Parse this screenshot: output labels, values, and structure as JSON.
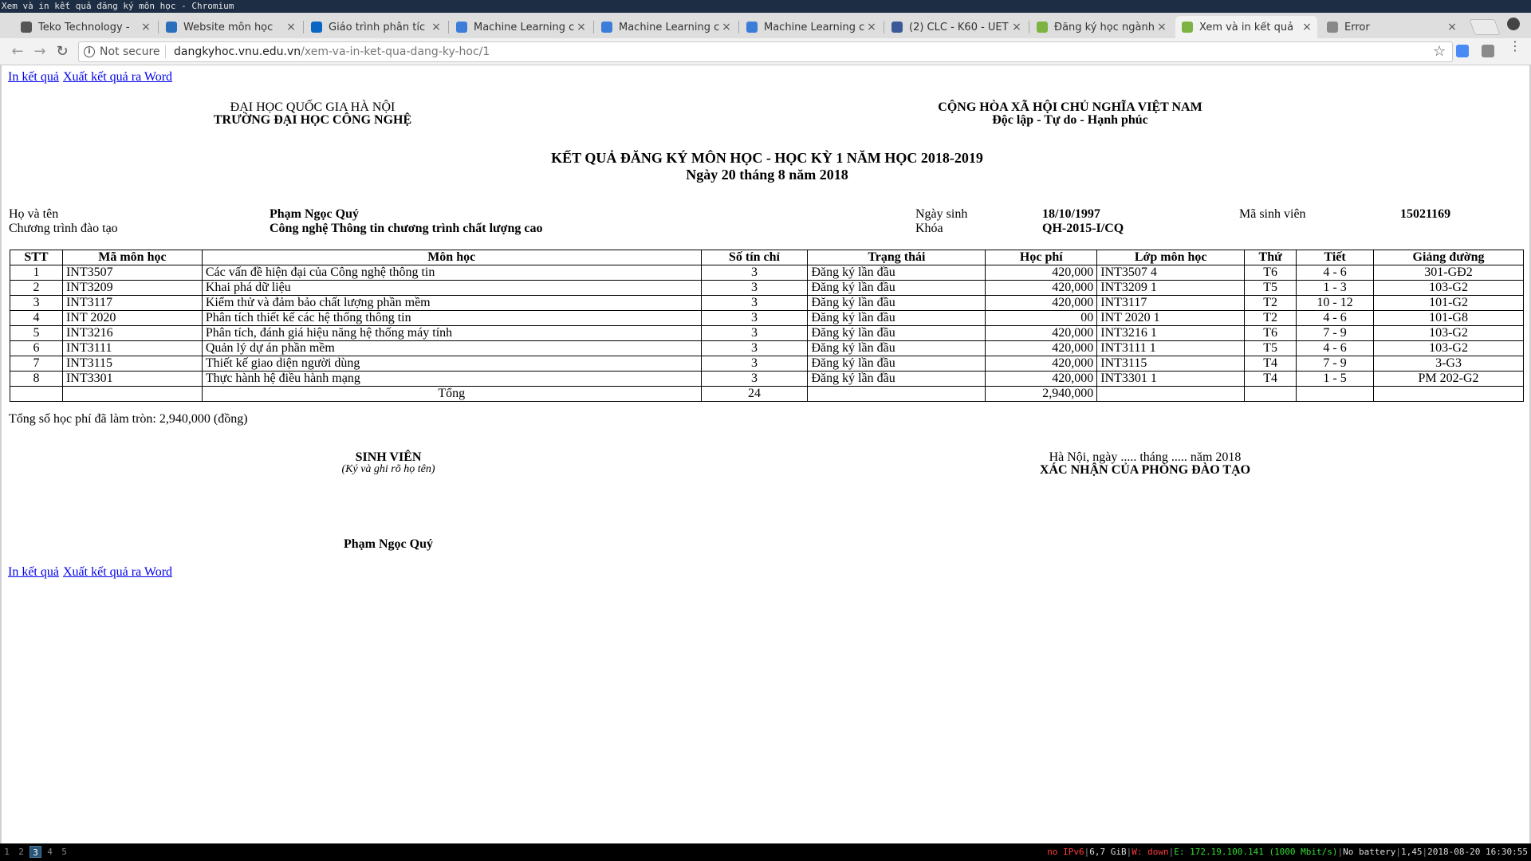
{
  "window": {
    "title": "Xem và in kết quả đăng ký môn học - Chromium"
  },
  "tabs": [
    {
      "title": "Teko Technology - ",
      "favicon": "teko-icon",
      "color": "#555555"
    },
    {
      "title": "Website môn học",
      "favicon": "globe-icon",
      "color": "#2a6fbb"
    },
    {
      "title": "Giáo trình phân tíc",
      "favicon": "linkedin-icon",
      "color": "#0a66c2"
    },
    {
      "title": "Machine Learning c",
      "favicon": "ml-blog-icon",
      "color": "#3b7dd8"
    },
    {
      "title": "Machine Learning c",
      "favicon": "ml-blog-icon",
      "color": "#3b7dd8"
    },
    {
      "title": "Machine Learning c",
      "favicon": "ml-blog-icon",
      "color": "#3b7dd8"
    },
    {
      "title": "(2) CLC - K60 - UET",
      "favicon": "facebook-icon",
      "color": "#3b5998"
    },
    {
      "title": "Đăng ký học ngành",
      "favicon": "vnu-icon",
      "color": "#7cb342"
    },
    {
      "title": "Xem và in kết quả",
      "favicon": "vnu-icon",
      "color": "#7cb342",
      "active": true
    },
    {
      "title": "Error",
      "favicon": "page-icon",
      "color": "#888888"
    }
  ],
  "toolbar": {
    "security_label": "Not secure",
    "url_host": "dangkyhoc.vnu.edu.vn",
    "url_path": "/xem-va-in-ket-qua-dang-ky-hoc/1"
  },
  "page": {
    "print_link": "In kết quả",
    "export_word_link": "Xuất kết quả ra Word",
    "university": "ĐẠI HỌC QUỐC GIA HÀ NỘI",
    "school": "TRƯỜNG ĐẠI HỌC CÔNG NGHỆ",
    "country": "CỘNG HÒA XÃ HỘI CHỦ NGHĨA VIỆT NAM",
    "motto": "Độc lập - Tự do - Hạnh phúc",
    "report_title": "KẾT QUẢ ĐĂNG KÝ MÔN HỌC - HỌC KỲ 1 NĂM HỌC 2018-2019",
    "report_date": "Ngày 20 tháng 8 năm 2018",
    "student": {
      "name_label": "Họ và tên",
      "name": "Phạm Ngọc Quý",
      "program_label": "Chương trình đào tạo",
      "program": "Công nghệ Thông tin chương trình chất lượng cao",
      "dob_label": "Ngày sinh",
      "dob": "18/10/1997",
      "cohort_label": "Khóa",
      "cohort": "QH-2015-I/CQ",
      "id_label": "Mã sinh viên",
      "id": "15021169"
    },
    "table": {
      "headers": [
        "STT",
        "Mã môn học",
        "Môn học",
        "Số tín chỉ",
        "Trạng thái",
        "Học phí",
        "Lớp môn học",
        "Thứ",
        "Tiết",
        "Giảng đường"
      ],
      "rows": [
        [
          "1",
          "INT3507",
          "Các vấn đề hiện đại của Công nghệ thông tin",
          "3",
          "Đăng ký lần đầu",
          "420,000",
          "INT3507 4",
          "T6",
          "4 - 6",
          "301-GĐ2"
        ],
        [
          "2",
          "INT3209",
          "Khai phá dữ liệu",
          "3",
          "Đăng ký lần đầu",
          "420,000",
          "INT3209 1",
          "T5",
          "1 - 3",
          "103-G2"
        ],
        [
          "3",
          "INT3117",
          "Kiểm thử và đảm bảo chất lượng phần mềm",
          "3",
          "Đăng ký lần đầu",
          "420,000",
          "INT3117",
          "T2",
          "10 - 12",
          "101-G2"
        ],
        [
          "4",
          "INT 2020",
          "Phân tích thiết kế các hệ thống thông tin",
          "3",
          "Đăng ký lần đầu",
          "00",
          "INT 2020 1",
          "T2",
          "4 - 6",
          "101-G8"
        ],
        [
          "5",
          "INT3216",
          "Phân tích, đánh giá hiệu năng hệ thống máy tính",
          "3",
          "Đăng ký lần đầu",
          "420,000",
          "INT3216 1",
          "T6",
          "7 - 9",
          "103-G2"
        ],
        [
          "6",
          "INT3111",
          "Quản lý dự án phần mềm",
          "3",
          "Đăng ký lần đầu",
          "420,000",
          "INT3111 1",
          "T5",
          "4 - 6",
          "103-G2"
        ],
        [
          "7",
          "INT3115",
          "Thiết kế giao diện người dùng",
          "3",
          "Đăng ký lần đầu",
          "420,000",
          "INT3115",
          "T4",
          "7 - 9",
          "3-G3"
        ],
        [
          "8",
          "INT3301",
          "Thực hành hệ điều hành mạng",
          "3",
          "Đăng ký lần đầu",
          "420,000",
          "INT3301 1",
          "T4",
          "1 - 5",
          "PM 202-G2"
        ]
      ],
      "total_label": "Tổng",
      "total_credits": "24",
      "total_fee": "2,940,000"
    },
    "fee_summary": "Tổng số học phí đã làm tròn: 2,940,000 (đồng)",
    "sign_student_title": "SINH VIÊN",
    "sign_student_note": "(Ký và ghi rõ họ tên)",
    "sign_place_date": "Hà Nội, ngày ..... tháng ..... năm 2018",
    "sign_office": "XÁC NHẬN CỦA PHÒNG ĐÀO TẠO",
    "sign_student_name": "Phạm Ngọc Quý"
  },
  "statusbar": {
    "workspaces": [
      "1",
      "2",
      "3",
      "4",
      "5"
    ],
    "active_workspace": "3",
    "ipv6": "no IPv6",
    "disk": "6,7 GiB",
    "wifi": "W: down",
    "ethernet": "E: 172.19.100.141 (1000 Mbit/s)",
    "battery": "No battery",
    "load": "1,45",
    "datetime": "2018-08-20 16:30:55"
  }
}
